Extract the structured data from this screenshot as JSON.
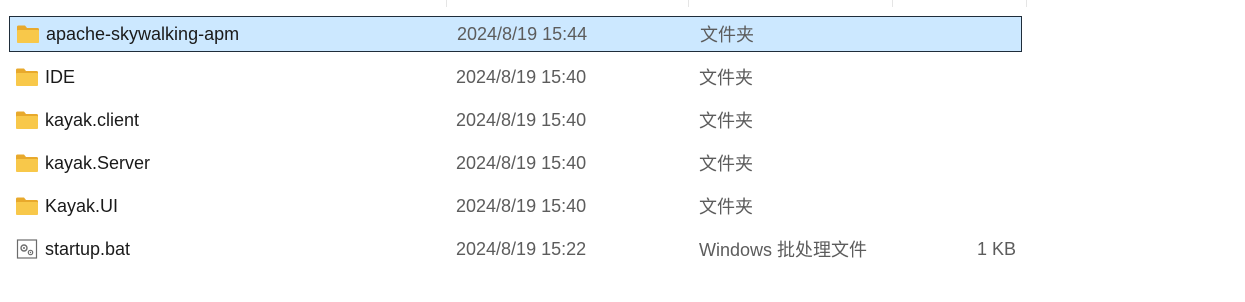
{
  "files": [
    {
      "name": "apache-skywalking-apm",
      "date": "2024/8/19 15:44",
      "type": "文件夹",
      "size": "",
      "icon": "folder-icon",
      "selected": true
    },
    {
      "name": "IDE",
      "date": "2024/8/19 15:40",
      "type": "文件夹",
      "size": "",
      "icon": "folder-icon",
      "selected": false
    },
    {
      "name": "kayak.client",
      "date": "2024/8/19 15:40",
      "type": "文件夹",
      "size": "",
      "icon": "folder-icon",
      "selected": false
    },
    {
      "name": "kayak.Server",
      "date": "2024/8/19 15:40",
      "type": "文件夹",
      "size": "",
      "icon": "folder-icon",
      "selected": false
    },
    {
      "name": "Kayak.UI",
      "date": "2024/8/19 15:40",
      "type": "文件夹",
      "size": "",
      "icon": "folder-icon",
      "selected": false
    },
    {
      "name": "startup.bat",
      "date": "2024/8/19 15:22",
      "type": "Windows 批处理文件",
      "size": "1 KB",
      "icon": "batch-file-icon",
      "selected": false
    }
  ],
  "colors": {
    "selection_background": "#cce8ff",
    "selection_border": "#1f2d3a",
    "folder_yellow": "#f8c84a",
    "secondary_text": "#5c5c5c"
  }
}
